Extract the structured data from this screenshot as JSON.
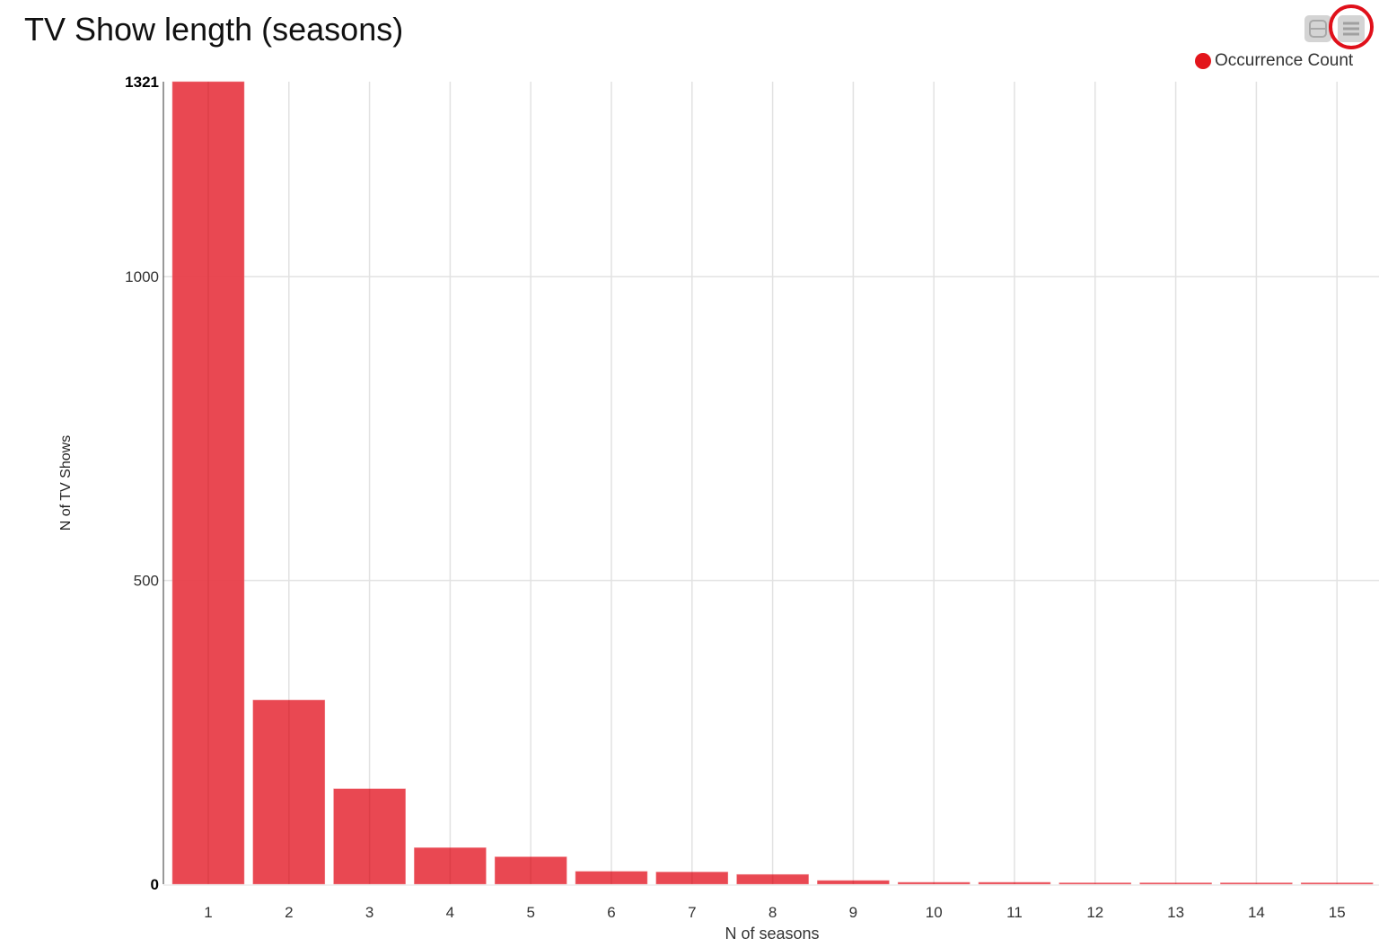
{
  "chart_data": {
    "type": "bar",
    "title": "TV Show length (seasons)",
    "xlabel": "N of seasons",
    "ylabel": "N of TV Shows",
    "categories": [
      "1",
      "2",
      "3",
      "4",
      "5",
      "6",
      "7",
      "8",
      "9",
      "10",
      "11",
      "12",
      "13",
      "14",
      "15"
    ],
    "series": [
      {
        "name": "Occurrence Count",
        "color": "#e8424c",
        "values": [
          1321,
          303,
          157,
          60,
          45,
          21,
          20,
          16,
          6,
          3,
          3,
          2,
          2,
          2,
          2
        ]
      }
    ],
    "ylim": [
      0,
      1321
    ],
    "yticks": [
      "0",
      "500",
      "1000",
      "1321"
    ],
    "grid": true,
    "legend": "top-right"
  },
  "toolbar": {
    "collapse_icon": "collapse-icon",
    "menu_icon": "hamburger-menu-icon"
  },
  "annotation": {
    "highlight": "red circle around menu button"
  }
}
